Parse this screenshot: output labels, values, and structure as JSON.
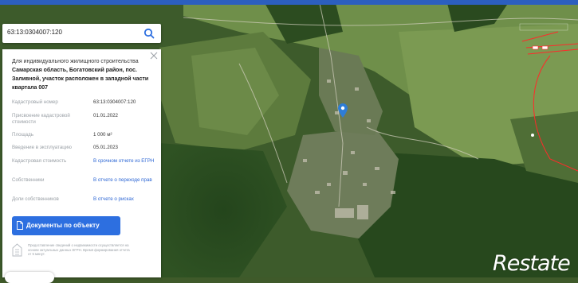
{
  "search": {
    "value": "63:13:0304007:120"
  },
  "panel": {
    "purpose": "Для индивидуального жилищного строительства",
    "address": "Самарская область, Богатовский район, пос. Заливной, участок расположен в западной части квартала 007",
    "rows": [
      {
        "label": "Кадастровый номер",
        "value": "63:13:0304007:120",
        "link": false
      },
      {
        "label": "Присвоение кадастровой стоимости",
        "value": "01.01.2022",
        "link": false
      },
      {
        "label": "Площадь",
        "value": "1 000 м²",
        "link": false
      },
      {
        "label": "Введение в эксплуатацию",
        "value": "05.01.2023",
        "link": false
      },
      {
        "label": "Кадастровая стоимость",
        "value": "В срочном отчете из ЕГРН",
        "link": true
      },
      {
        "label": "Собственники",
        "value": "В отчете о переходе прав",
        "link": true
      },
      {
        "label": "Доли собственников",
        "value": "В отчете о рисках",
        "link": true
      }
    ],
    "docs_button": "Документы по объекту",
    "note": "Предоставление сведений о недвижимости осуществляется на основе актуальных данных ЕГРН. Время формирования отчета от 5 минут."
  },
  "watermark": "Restate",
  "colors": {
    "accent": "#2d6fe0",
    "link": "#2c66d4",
    "marker": "#2e7dd6",
    "parcel_outline": "#ff2a2a"
  },
  "icons": {
    "search": "magnifier",
    "close": "x",
    "document": "document",
    "info": "building-info",
    "marker": "map-pin"
  }
}
